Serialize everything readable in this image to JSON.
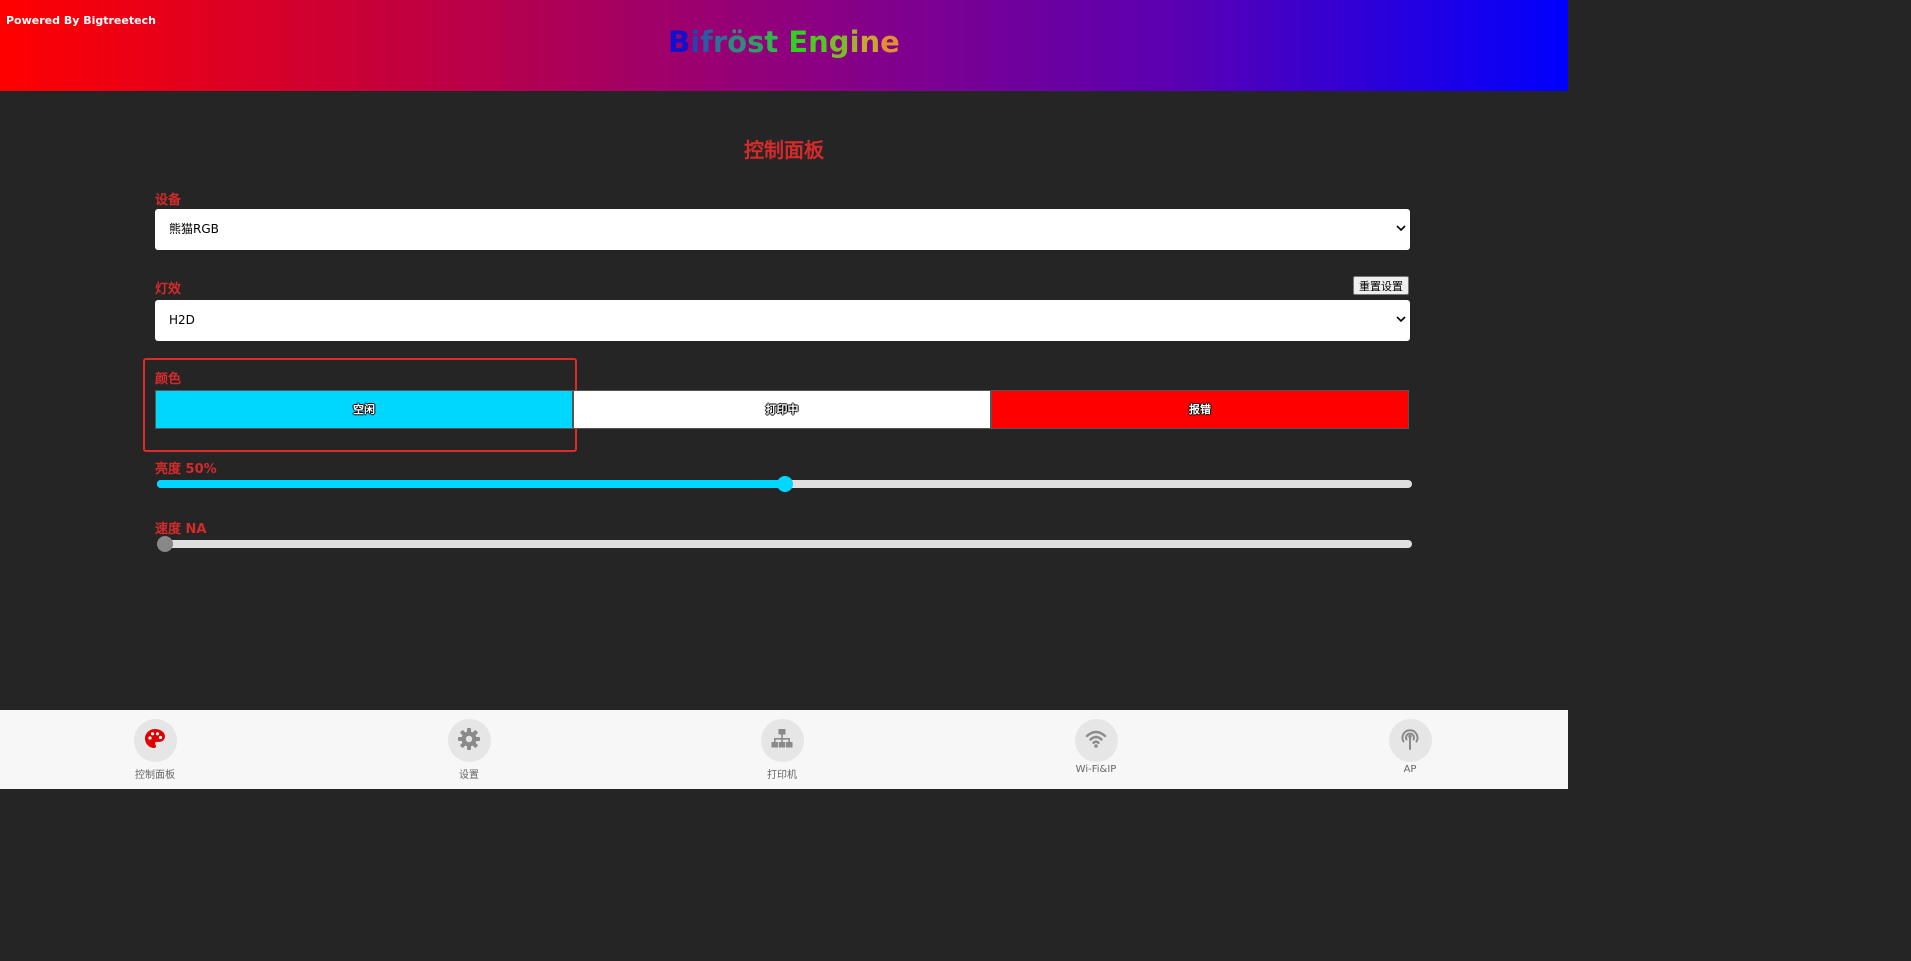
{
  "header": {
    "powered_by": "Powered By Bigtreetech",
    "brand": {
      "letters": [
        "B",
        "i",
        "f",
        "r",
        "ö",
        "s",
        "t",
        " ",
        "E",
        "n",
        "g",
        "i",
        "n",
        "e"
      ],
      "colors": [
        "#1010d0",
        "#2a3fb0",
        "#2a5aa6",
        "#2f6f96",
        "#2f8a7e",
        "#2f9f64",
        "#2fb84a",
        "#2fb84a",
        "#30d01e",
        "#52c622",
        "#7bbc26",
        "#a1b22a",
        "#c6a82e",
        "#e09030"
      ]
    }
  },
  "page_title": "控制面板",
  "device": {
    "label": "设备",
    "selected": "熊猫RGB"
  },
  "effect": {
    "label": "灯效",
    "selected": "H2D",
    "reset_label": "重置设置"
  },
  "color": {
    "label": "颜色",
    "buttons": [
      {
        "label": "空闲",
        "color": "#00d7ff"
      },
      {
        "label": "打印中",
        "color": "#ffffff"
      },
      {
        "label": "报错",
        "color": "#ff0000"
      }
    ]
  },
  "brightness": {
    "label": "亮度 50%",
    "value": 0.5,
    "color": "#00d7ff"
  },
  "speed": {
    "label": "速度 NA",
    "value": 0.0,
    "color": "#888888"
  },
  "nav": {
    "items": [
      {
        "label": "控制面板",
        "icon": "palette-icon",
        "active": true
      },
      {
        "label": "设置",
        "icon": "gear-icon",
        "active": false
      },
      {
        "label": "打印机",
        "icon": "network-icon",
        "active": false
      },
      {
        "label": "Wi-Fi&IP",
        "icon": "wifi-icon",
        "active": false
      },
      {
        "label": "AP",
        "icon": "antenna-icon",
        "active": false
      }
    ]
  }
}
